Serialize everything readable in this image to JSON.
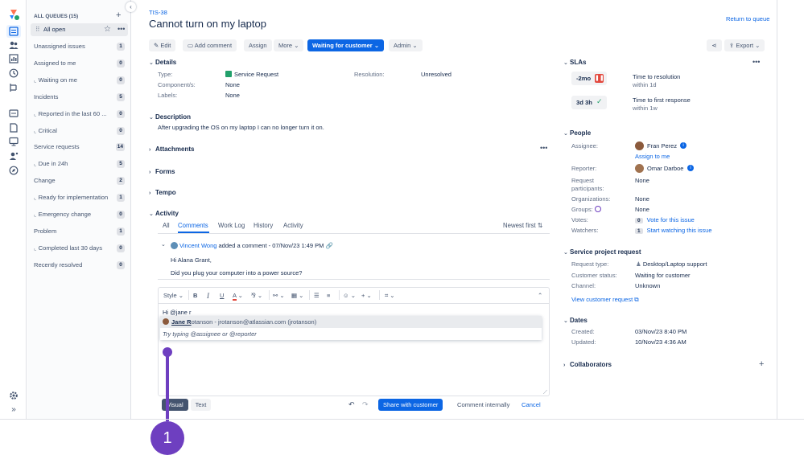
{
  "rail": {
    "icons": [
      "product-logo-icon",
      "queues-icon",
      "customers-icon",
      "reports-icon",
      "sla-icon",
      "raise-request-icon",
      "channels-icon",
      "knowledge-base-icon",
      "operations-icon",
      "directory-icon",
      "explore-icon",
      "settings-icon",
      "expand-icon"
    ]
  },
  "sidebar": {
    "header": "ALL QUEUES (15)",
    "add_label": "+",
    "selected": "All open",
    "items": [
      {
        "label": "Unassigned issues",
        "count": "1",
        "sub": false
      },
      {
        "label": "Assigned to me",
        "count": "0",
        "sub": false
      },
      {
        "label": "Waiting on me",
        "count": "0",
        "sub": true
      },
      {
        "label": "Incidents",
        "count": "5",
        "sub": false
      },
      {
        "label": "Reported in the last 60 ...",
        "count": "0",
        "sub": true
      },
      {
        "label": "Critical",
        "count": "0",
        "sub": true
      },
      {
        "label": "Service requests",
        "count": "14",
        "sub": false
      },
      {
        "label": "Due in 24h",
        "count": "5",
        "sub": true
      },
      {
        "label": "Change",
        "count": "2",
        "sub": false
      },
      {
        "label": "Ready for implementation",
        "count": "1",
        "sub": true
      },
      {
        "label": "Emergency change",
        "count": "0",
        "sub": true
      },
      {
        "label": "Problem",
        "count": "1",
        "sub": false
      },
      {
        "label": "Completed last 30 days",
        "count": "0",
        "sub": true
      },
      {
        "label": "Recently resolved",
        "count": "0",
        "sub": false
      }
    ]
  },
  "issue": {
    "key": "TIS-38",
    "title": "Cannot turn on my laptop",
    "return_label": "Return to queue",
    "toolbar": {
      "edit": "Edit",
      "add_comment": "Add comment",
      "assign": "Assign",
      "more": "More",
      "status": "Waiting for customer",
      "admin": "Admin",
      "export": "Export"
    },
    "details": {
      "heading": "Details",
      "type_label": "Type:",
      "type_value": "Service Request",
      "components_label": "Component/s:",
      "components_value": "None",
      "labels_label": "Labels:",
      "labels_value": "None",
      "resolution_label": "Resolution:",
      "resolution_value": "Unresolved"
    },
    "description": {
      "heading": "Description",
      "text": "After upgrading the OS on my laptop I can no longer turn it on."
    },
    "attachments": "Attachments",
    "forms": "Forms",
    "tempo": "Tempo",
    "activity": {
      "heading": "Activity",
      "tabs": [
        "All",
        "Comments",
        "Work Log",
        "History",
        "Activity"
      ],
      "sort": "Newest first",
      "author": "Vincent Wong",
      "meta": "added a comment - 07/Nov/23 1:49 PM",
      "line1": "Hi Alana Grant,",
      "line2": "Did you plug your computer into a power source?"
    },
    "editor": {
      "style": "Style",
      "draft": "Hi @jane r",
      "mention_name_bold": "Jane R",
      "mention_name_rest": "otanson",
      "mention_email": " - jrotanson@atlassian.com (jrotanson)",
      "hint": "Try typing @assignee or @reporter",
      "visual": "Visual",
      "text": "Text",
      "share": "Share with customer",
      "internal": "Comment internally",
      "cancel": "Cancel"
    },
    "step_marker": "1"
  },
  "right": {
    "slas_heading": "SLAs",
    "sla1_time": "-2mo",
    "sla1_name": "Time to resolution",
    "sla1_within": "within 1d",
    "sla2_time": "3d 3h",
    "sla2_name": "Time to first response",
    "sla2_within": "within 1w",
    "people_heading": "People",
    "assignee_label": "Assignee:",
    "assignee": "Fran Perez",
    "assign_to_me": "Assign to me",
    "reporter_label": "Reporter:",
    "reporter": "Omar Darboe",
    "participants_label": "Request participants:",
    "participants": "None",
    "orgs_label": "Organizations:",
    "orgs": "None",
    "groups_label": "Groups:",
    "groups": "None",
    "votes_label": "Votes:",
    "votes_count": "0",
    "votes_link": "Vote for this issue",
    "watchers_label": "Watchers:",
    "watchers_count": "1",
    "watchers_link": "Start watching this issue",
    "spr_heading": "Service project request",
    "req_type_label": "Request type:",
    "req_type": "Desktop/Laptop support",
    "cust_status_label": "Customer status:",
    "cust_status": "Waiting for customer",
    "channel_label": "Channel:",
    "channel": "Unknown",
    "view_request": "View customer request",
    "dates_heading": "Dates",
    "created_label": "Created:",
    "created": "03/Nov/23 8:40 PM",
    "updated_label": "Updated:",
    "updated": "10/Nov/23 4:36 AM",
    "collab_heading": "Collaborators"
  },
  "colors": {
    "brand": "#0c66e4",
    "marker": "#6e3fc0",
    "sla_breach": "#e2483d",
    "sla_ok": "#22a06b"
  }
}
